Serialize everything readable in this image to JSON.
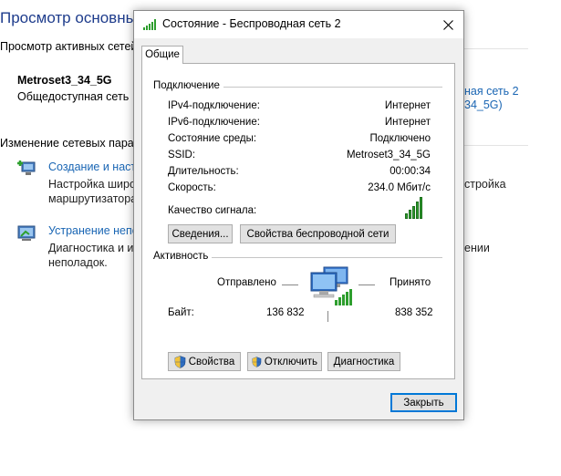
{
  "background": {
    "title": "Просмотр основных",
    "active_networks_heading": "Просмотр активных сетей",
    "network_name": "Metroset3_34_5G",
    "network_type": "Общедоступная сеть",
    "connection_link_line1": "ная сеть 2",
    "connection_link_line2": "34_5G)",
    "change_settings_heading": "Изменение сетевых парам",
    "setup_link": "Создание и настр",
    "setup_desc_line1": "Настройка широ",
    "setup_desc_line2": "маршрутизатора",
    "setup_desc_right": "стройка",
    "troubleshoot_link": "Устранение непо",
    "troubleshoot_desc_line1": "Диагностика и ис",
    "troubleshoot_desc_line2": "неполадок.",
    "troubleshoot_desc_right": "ении"
  },
  "dialog": {
    "title": "Состояние - Беспроводная сеть 2",
    "tab": "Общие",
    "connection_group": "Подключение",
    "fields": [
      {
        "label": "IPv4-подключение:",
        "value": "Интернет"
      },
      {
        "label": "IPv6-подключение:",
        "value": "Интернет"
      },
      {
        "label": "Состояние среды:",
        "value": "Подключено"
      },
      {
        "label": "SSID:",
        "value": "Metroset3_34_5G"
      },
      {
        "label": "Длительность:",
        "value": "00:00:34"
      },
      {
        "label": "Скорость:",
        "value": "234.0 Мбит/с"
      }
    ],
    "signal_quality_label": "Качество сигнала:",
    "signal_bars_lit": 5,
    "details_button": "Сведения...",
    "wireless_props_button": "Свойства беспроводной сети",
    "activity_group": "Активность",
    "sent_label": "Отправлено",
    "received_label": "Принято",
    "bytes_label": "Байт:",
    "bytes_sent": "136 832",
    "bytes_received": "838 352",
    "properties_button": "Свойства",
    "disable_button": "Отключить",
    "diagnose_button": "Диагностика",
    "close_button": "Закрыть"
  },
  "colors": {
    "link": "#1a66b4",
    "title_blue": "#1e3c8c",
    "signal_green": "#2e9e2e",
    "default_button_border": "#0078d7"
  },
  "icons": [
    "wifi-signal-icon",
    "close-icon",
    "shield-icon",
    "network-computers-icon",
    "network-setup-icon",
    "troubleshoot-icon"
  ]
}
